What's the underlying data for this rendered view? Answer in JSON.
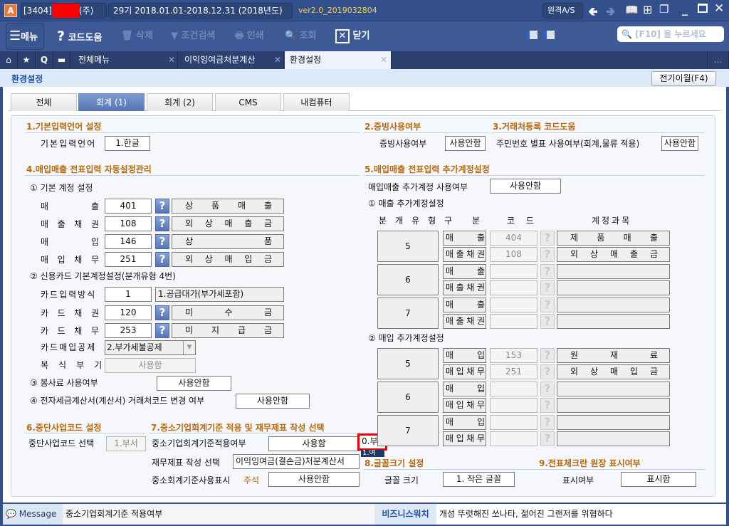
{
  "titlebar": {
    "company_code": "[3404]",
    "company_suffix": "(주)",
    "period": "29기  2018.01.01-2018.12.31",
    "year": "(2018년도)",
    "version": "ver2.0_2019032804",
    "remote_as": "원격A/S"
  },
  "toolbar": {
    "menu": "메뉴",
    "code_help": "코드도움",
    "delete": "삭제",
    "condition_search": "조건검색",
    "print": "인쇄",
    "inquiry": "조회",
    "close": "닫기",
    "search_placeholder": "[F10] 을 누르세요"
  },
  "tabs": [
    {
      "label": "전체메뉴"
    },
    {
      "label": "이익잉여금처분계산"
    },
    {
      "label": "환경설정"
    }
  ],
  "page": {
    "title": "환경설정",
    "carry_over": "전기이월(F4)"
  },
  "inner_tabs": [
    "전체",
    "회계 (1)",
    "회계 (2)",
    "CMS",
    "내컴퓨터"
  ],
  "sec1": {
    "title": "1.기본입력언어 설정",
    "label": "기본입력언어",
    "value": "1.한글"
  },
  "sec2": {
    "title": "2.증빙사용여부",
    "label": "증빙사용여부",
    "value": "사용안함"
  },
  "sec3": {
    "title": "3.거래처등록 코드도움",
    "label": "주민번호 별표 사용여부(회계,물류 적용)",
    "value": "사용안함"
  },
  "sec4": {
    "title": "4.매입매출 전표입력 자동설정관리",
    "sub1": "① 기본 계정 설정",
    "accounts": [
      {
        "label": "매출",
        "code": "401",
        "name": "상품매출"
      },
      {
        "label": "매출채권",
        "code": "108",
        "name": "외상매출금"
      },
      {
        "label": "매입",
        "code": "146",
        "name": "상품"
      },
      {
        "label": "매입채무",
        "code": "251",
        "name": "외상매입금"
      }
    ],
    "sub2": "② 신용카드 기본계정설정(분개유형 4번)",
    "card_input_label": "카드입력방식",
    "card_input_code": "1",
    "card_input_desc": "1.공급대가(부가세포함)",
    "card_accounts": [
      {
        "label": "카드채권",
        "code": "120",
        "name": "미수금"
      },
      {
        "label": "카드채무",
        "code": "253",
        "name": "미지급금"
      }
    ],
    "card_deduct_label": "카드매입공제",
    "card_deduct_value": "2.부가세불공제",
    "double_entry_label": "복식부기",
    "double_entry_value": "사용함",
    "sub3": "③ 봉사료 사용여부",
    "service_value": "사용안함",
    "sub4": "④ 전자세금계산서(계산서) 거래처코드 변경 여부",
    "etax_value": "사용안함"
  },
  "sec5": {
    "title": "5.매입매출 전표입력 추가계정설정",
    "use_label": "매입매출 추가계정 사용여부",
    "use_value": "사용안함",
    "sales_sub": "① 매출 추가계정설정",
    "purchase_sub": "② 매입 추가계정설정",
    "headers": [
      "분개유형",
      "구분",
      "코드",
      "계정과목"
    ],
    "sales": [
      {
        "type": "5",
        "rows": [
          {
            "kind": "매출",
            "code": "404",
            "name": "제품매출"
          },
          {
            "kind": "매출채권",
            "code": "108",
            "name": "외상매출금"
          }
        ]
      },
      {
        "type": "6",
        "rows": [
          {
            "kind": "매출",
            "code": "",
            "name": ""
          },
          {
            "kind": "매출채권",
            "code": "",
            "name": ""
          }
        ]
      },
      {
        "type": "7",
        "rows": [
          {
            "kind": "매출",
            "code": "",
            "name": ""
          },
          {
            "kind": "매출채권",
            "code": "",
            "name": ""
          }
        ]
      }
    ],
    "purchase": [
      {
        "type": "5",
        "rows": [
          {
            "kind": "매입",
            "code": "153",
            "name": "원재료"
          },
          {
            "kind": "매입채무",
            "code": "251",
            "name": "외상매입금"
          }
        ]
      },
      {
        "type": "6",
        "rows": [
          {
            "kind": "매입",
            "code": "",
            "name": ""
          },
          {
            "kind": "매입채무",
            "code": "",
            "name": ""
          }
        ]
      },
      {
        "type": "7",
        "rows": [
          {
            "kind": "매입",
            "code": "",
            "name": ""
          },
          {
            "kind": "매입채무",
            "code": "",
            "name": ""
          }
        ]
      }
    ]
  },
  "sec6": {
    "title": "6.중단사업코드 설정",
    "label": "중단사업코드 선택",
    "value": "1.부서"
  },
  "sec7": {
    "title": "7.중소기업회계기준 적용 및 재무제표 작성 선택",
    "apply_label": "중소기업회계기준적용여부",
    "apply_value": "사용함",
    "dropdown_selected": "0.부",
    "dropdown_option": "1.여",
    "fs_label": "재무제표 작성 선택",
    "fs_value": "이익잉여금(결손금)처분계산서",
    "mark_label": "중소회계기준사용표시",
    "mark_note": "주석",
    "mark_value": "사용안함"
  },
  "sec8": {
    "title": "8.글꼴크기 설정",
    "label": "글꼴 크기",
    "value": "1. 작은 글꼴"
  },
  "sec9": {
    "title": "9.전표체크란 원장 표시여부",
    "label": "표시여부",
    "value": "표시함"
  },
  "status": {
    "message_label": "Message",
    "message": "중소기업회계기준 적용여부",
    "news_label": "비즈니스워치",
    "news": "개성 뚜렷해진 쏘나타, 젊어진 그랜저를 위협하다"
  }
}
